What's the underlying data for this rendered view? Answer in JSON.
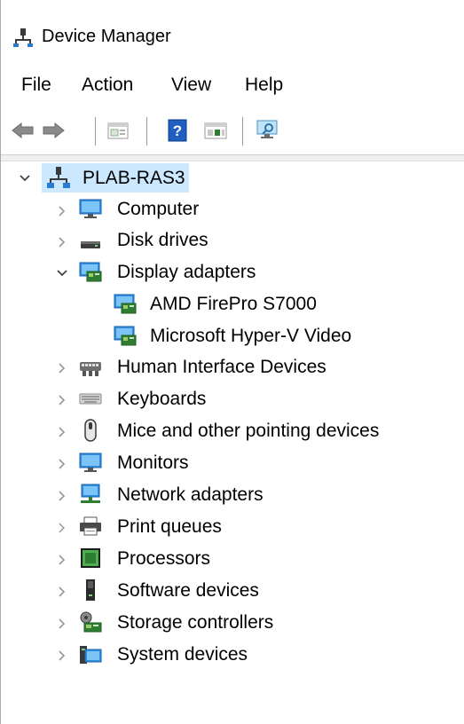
{
  "title": "Device Manager",
  "menu": {
    "file": "File",
    "action": "Action",
    "view": "View",
    "help": "Help"
  },
  "toolbar": {
    "buttons": [
      "back-icon",
      "forward-icon",
      "properties-icon",
      "help-icon",
      "update-driver-icon",
      "scan-hardware-icon"
    ]
  },
  "tree": {
    "root": "PLAB-RAS3",
    "categories": {
      "computer": "Computer",
      "disk": "Disk drives",
      "display": "Display adapters",
      "hid": "Human Interface Devices",
      "keyboards": "Keyboards",
      "mice": "Mice and other pointing devices",
      "monitors": "Monitors",
      "network": "Network adapters",
      "print": "Print queues",
      "processors": "Processors",
      "software": "Software devices",
      "storage": "Storage controllers",
      "system": "System devices"
    },
    "display_children": {
      "amd": "AMD FirePro S7000",
      "hyperv": "Microsoft Hyper-V Video"
    }
  }
}
